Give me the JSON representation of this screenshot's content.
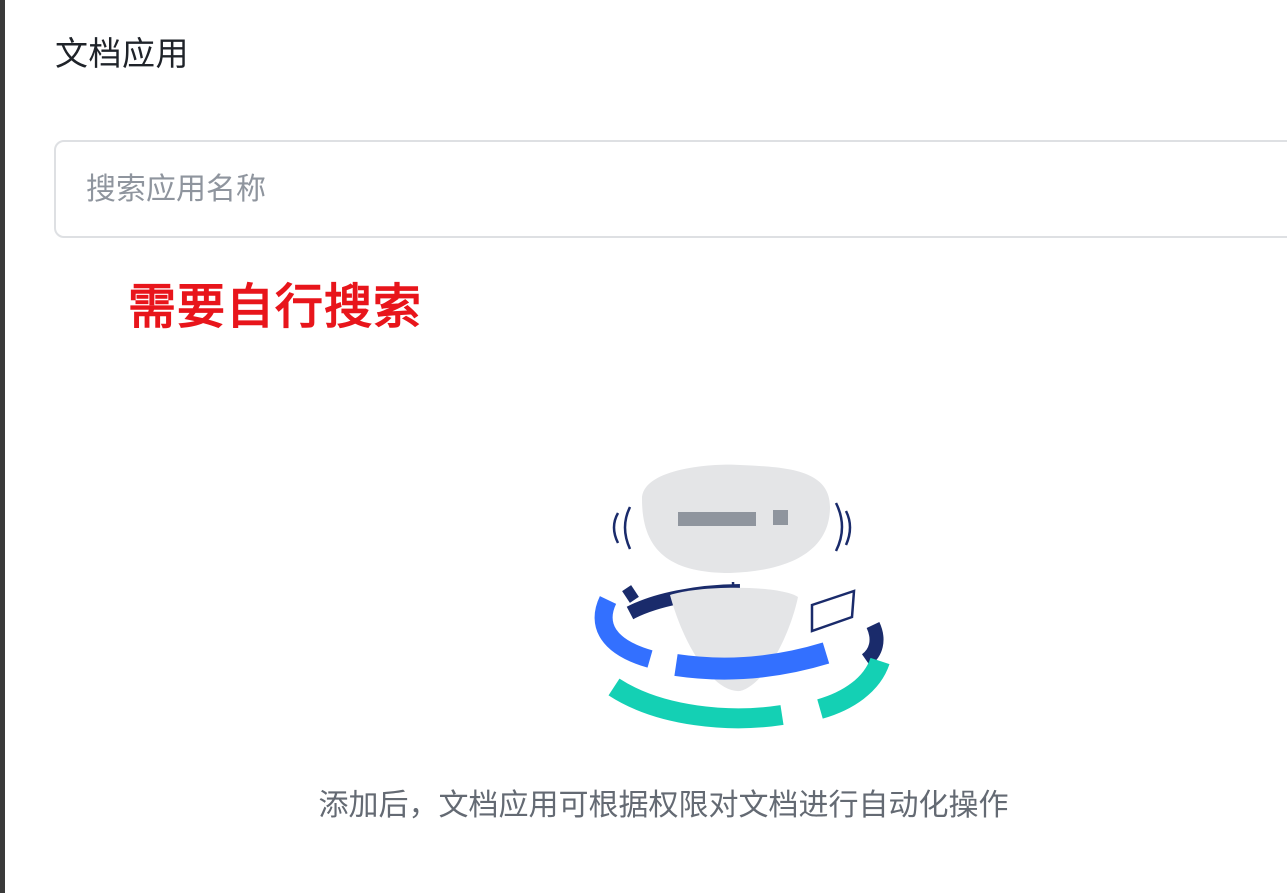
{
  "panel": {
    "title": "文档应用"
  },
  "search": {
    "placeholder": "搜索应用名称",
    "value": ""
  },
  "annotation": {
    "text": "需要自行搜索",
    "color": "#e8151b"
  },
  "empty_state": {
    "illustration_icon": "robot-empty-icon",
    "message": "添加后，文档应用可根据权限对文档进行自动化操作"
  },
  "colors": {
    "accent_blue": "#3370ff",
    "accent_teal": "#14d0b4",
    "dark_navy": "#1a2b6b",
    "robot_gray": "#e4e5e7"
  }
}
